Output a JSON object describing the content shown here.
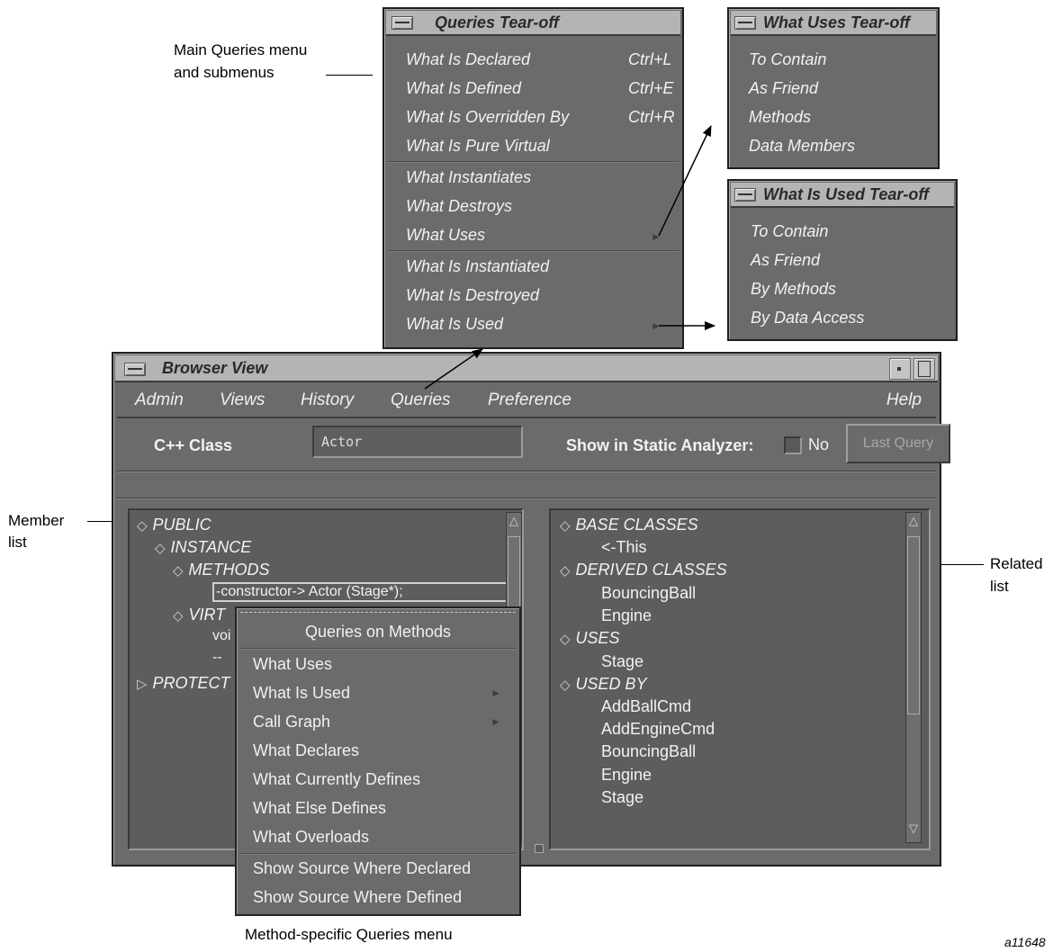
{
  "callouts": {
    "main_queries_line1": "Main Queries menu",
    "main_queries_line2": "and submenus",
    "member_line1": "Member",
    "member_line2": "list",
    "related_line1": "Related",
    "related_line2": "list",
    "method_specific": "Method-specific Queries menu",
    "figure_id": "a11648"
  },
  "queries_tearoff": {
    "title": "Queries Tear-off",
    "items": [
      {
        "label": "What Is Declared",
        "accel": "Ctrl+L"
      },
      {
        "label": "What Is Defined",
        "accel": "Ctrl+E"
      },
      {
        "label": "What Is Overridden By",
        "accel": "Ctrl+R"
      },
      {
        "label": "What Is Pure Virtual",
        "accel": ""
      },
      {
        "label": "What Instantiates",
        "accel": ""
      },
      {
        "label": "What Destroys",
        "accel": ""
      },
      {
        "label": "What Uses",
        "accel": ""
      },
      {
        "label": "What Is Instantiated",
        "accel": ""
      },
      {
        "label": "What Is Destroyed",
        "accel": ""
      },
      {
        "label": "What Is Used",
        "accel": ""
      }
    ]
  },
  "what_uses_tearoff": {
    "title": "What Uses Tear-off",
    "items": [
      "To Contain",
      "As Friend",
      "Methods",
      "Data Members"
    ]
  },
  "what_is_used_tearoff": {
    "title": "What Is Used Tear-off",
    "items": [
      "To Contain",
      "As Friend",
      "By Methods",
      "By Data Access"
    ]
  },
  "browser": {
    "title": "Browser View",
    "menus": [
      "Admin",
      "Views",
      "History",
      "Queries",
      "Preference"
    ],
    "help": "Help",
    "class_label": "C++ Class",
    "class_value": "Actor",
    "show_label": "Show in Static Analyzer:",
    "show_value": "No",
    "last_query": "Last Query",
    "member_tree": {
      "public": "PUBLIC",
      "instance": "INSTANCE",
      "methods": "METHODS",
      "constructor": "-constructor-> Actor (Stage*);",
      "virtual_partial": "VIRT",
      "void_partial": "voi",
      "dash_partial": "--",
      "protected_partial": "PROTECT"
    },
    "related_tree": {
      "base_classes": "BASE CLASSES",
      "this": "<-This",
      "derived_classes": "DERIVED CLASSES",
      "derived": [
        "BouncingBall",
        "Engine"
      ],
      "uses": "USES",
      "uses_items": [
        "Stage"
      ],
      "used_by": "USED BY",
      "used_by_items": [
        "AddBallCmd",
        "AddEngineCmd",
        "BouncingBall",
        "Engine",
        "Stage"
      ]
    }
  },
  "context_menu": {
    "title": "Queries on Methods",
    "items": [
      "What Uses",
      "What Is Used",
      "Call Graph",
      "What Declares",
      "What Currently Defines",
      "What Else Defines",
      "What Overloads",
      "Show Source Where Declared",
      "Show Source Where Defined"
    ]
  }
}
